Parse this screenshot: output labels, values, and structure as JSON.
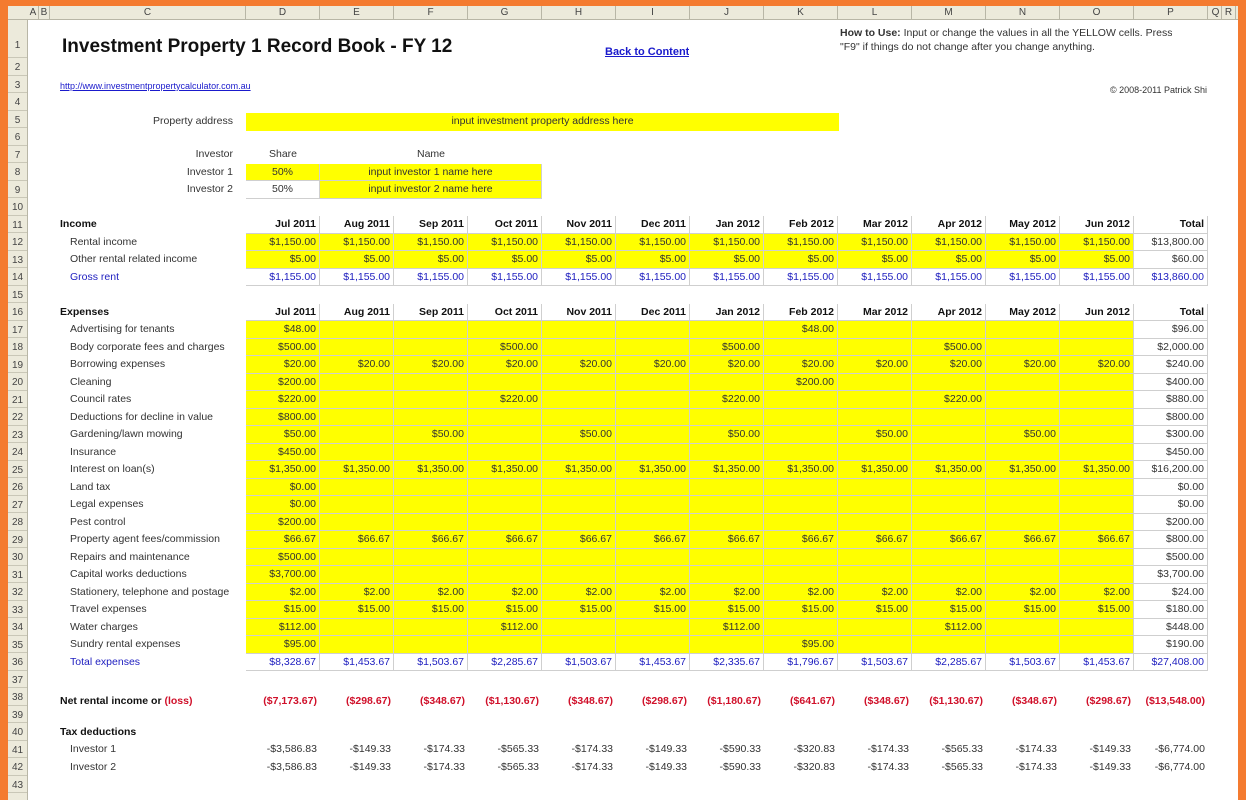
{
  "columns": [
    "A",
    "B",
    "C",
    "D",
    "E",
    "F",
    "G",
    "H",
    "I",
    "J",
    "K",
    "L",
    "M",
    "N",
    "O",
    "P",
    "Q",
    "R"
  ],
  "rows": [
    "1",
    "2",
    "3",
    "4",
    "5",
    "6",
    "7",
    "8",
    "9",
    "10",
    "11",
    "12",
    "13",
    "14",
    "15",
    "16",
    "17",
    "18",
    "19",
    "20",
    "21",
    "22",
    "23",
    "24",
    "25",
    "26",
    "27",
    "28",
    "29",
    "30",
    "31",
    "32",
    "33",
    "34",
    "35",
    "36",
    "37",
    "38",
    "39",
    "40",
    "41",
    "42",
    "43"
  ],
  "header": {
    "title": "Investment Property 1 Record Book - FY 12",
    "back_link": "Back to Content",
    "website_link": "http://www.investmentpropertycalculator.com.au",
    "how_to_use_label": "How to Use:",
    "how_to_use_text1": " Input or change the values in all the YELLOW cells. Press",
    "how_to_use_text2": "\"F9\" if things do not change after you change anything.",
    "copyright": "© 2008-2011 Patrick Shi"
  },
  "property": {
    "label": "Property address",
    "value": "input investment property address here"
  },
  "investors": {
    "col_investor": "Investor",
    "col_share": "Share",
    "col_name": "Name",
    "list": [
      {
        "label": "Investor 1",
        "share": "50%",
        "name": "input investor 1 name here"
      },
      {
        "label": "Investor 2",
        "share": "50%",
        "name": "input investor 2 name here"
      }
    ]
  },
  "months": [
    "Jul 2011",
    "Aug 2011",
    "Sep 2011",
    "Oct 2011",
    "Nov 2011",
    "Dec 2011",
    "Jan 2012",
    "Feb 2012",
    "Mar 2012",
    "Apr 2012",
    "May 2012",
    "Jun 2012"
  ],
  "total_label": "Total",
  "income": {
    "heading": "Income",
    "rows": [
      {
        "label": "Rental income",
        "values": [
          "$1,150.00",
          "$1,150.00",
          "$1,150.00",
          "$1,150.00",
          "$1,150.00",
          "$1,150.00",
          "$1,150.00",
          "$1,150.00",
          "$1,150.00",
          "$1,150.00",
          "$1,150.00",
          "$1,150.00"
        ],
        "total": "$13,800.00"
      },
      {
        "label": "Other rental related income",
        "values": [
          "$5.00",
          "$5.00",
          "$5.00",
          "$5.00",
          "$5.00",
          "$5.00",
          "$5.00",
          "$5.00",
          "$5.00",
          "$5.00",
          "$5.00",
          "$5.00"
        ],
        "total": "$60.00"
      }
    ],
    "gross": {
      "label": "Gross rent",
      "values": [
        "$1,155.00",
        "$1,155.00",
        "$1,155.00",
        "$1,155.00",
        "$1,155.00",
        "$1,155.00",
        "$1,155.00",
        "$1,155.00",
        "$1,155.00",
        "$1,155.00",
        "$1,155.00",
        "$1,155.00"
      ],
      "total": "$13,860.00"
    }
  },
  "expenses": {
    "heading": "Expenses",
    "rows": [
      {
        "label": "Advertising for tenants",
        "values": [
          "$48.00",
          "",
          "",
          "",
          "",
          "",
          "",
          "$48.00",
          "",
          "",
          "",
          ""
        ],
        "total": "$96.00"
      },
      {
        "label": "Body corporate fees and charges",
        "values": [
          "$500.00",
          "",
          "",
          "$500.00",
          "",
          "",
          "$500.00",
          "",
          "",
          "$500.00",
          "",
          ""
        ],
        "total": "$2,000.00"
      },
      {
        "label": "Borrowing expenses",
        "values": [
          "$20.00",
          "$20.00",
          "$20.00",
          "$20.00",
          "$20.00",
          "$20.00",
          "$20.00",
          "$20.00",
          "$20.00",
          "$20.00",
          "$20.00",
          "$20.00"
        ],
        "total": "$240.00"
      },
      {
        "label": "Cleaning",
        "values": [
          "$200.00",
          "",
          "",
          "",
          "",
          "",
          "",
          "$200.00",
          "",
          "",
          "",
          ""
        ],
        "total": "$400.00"
      },
      {
        "label": "Council rates",
        "values": [
          "$220.00",
          "",
          "",
          "$220.00",
          "",
          "",
          "$220.00",
          "",
          "",
          "$220.00",
          "",
          ""
        ],
        "total": "$880.00"
      },
      {
        "label": "Deductions for decline in value",
        "values": [
          "$800.00",
          "",
          "",
          "",
          "",
          "",
          "",
          "",
          "",
          "",
          "",
          ""
        ],
        "total": "$800.00"
      },
      {
        "label": "Gardening/lawn mowing",
        "values": [
          "$50.00",
          "",
          "$50.00",
          "",
          "$50.00",
          "",
          "$50.00",
          "",
          "$50.00",
          "",
          "$50.00",
          ""
        ],
        "total": "$300.00"
      },
      {
        "label": "Insurance",
        "values": [
          "$450.00",
          "",
          "",
          "",
          "",
          "",
          "",
          "",
          "",
          "",
          "",
          ""
        ],
        "total": "$450.00"
      },
      {
        "label": "Interest on loan(s)",
        "values": [
          "$1,350.00",
          "$1,350.00",
          "$1,350.00",
          "$1,350.00",
          "$1,350.00",
          "$1,350.00",
          "$1,350.00",
          "$1,350.00",
          "$1,350.00",
          "$1,350.00",
          "$1,350.00",
          "$1,350.00"
        ],
        "total": "$16,200.00"
      },
      {
        "label": "Land tax",
        "values": [
          "$0.00",
          "",
          "",
          "",
          "",
          "",
          "",
          "",
          "",
          "",
          "",
          ""
        ],
        "total": "$0.00"
      },
      {
        "label": "Legal expenses",
        "values": [
          "$0.00",
          "",
          "",
          "",
          "",
          "",
          "",
          "",
          "",
          "",
          "",
          ""
        ],
        "total": "$0.00"
      },
      {
        "label": "Pest control",
        "values": [
          "$200.00",
          "",
          "",
          "",
          "",
          "",
          "",
          "",
          "",
          "",
          "",
          ""
        ],
        "total": "$200.00"
      },
      {
        "label": "Property agent fees/commission",
        "values": [
          "$66.67",
          "$66.67",
          "$66.67",
          "$66.67",
          "$66.67",
          "$66.67",
          "$66.67",
          "$66.67",
          "$66.67",
          "$66.67",
          "$66.67",
          "$66.67"
        ],
        "total": "$800.00"
      },
      {
        "label": "Repairs and maintenance",
        "values": [
          "$500.00",
          "",
          "",
          "",
          "",
          "",
          "",
          "",
          "",
          "",
          "",
          ""
        ],
        "total": "$500.00"
      },
      {
        "label": "Capital works deductions",
        "values": [
          "$3,700.00",
          "",
          "",
          "",
          "",
          "",
          "",
          "",
          "",
          "",
          "",
          ""
        ],
        "total": "$3,700.00"
      },
      {
        "label": "Stationery, telephone and postage",
        "values": [
          "$2.00",
          "$2.00",
          "$2.00",
          "$2.00",
          "$2.00",
          "$2.00",
          "$2.00",
          "$2.00",
          "$2.00",
          "$2.00",
          "$2.00",
          "$2.00"
        ],
        "total": "$24.00"
      },
      {
        "label": "Travel expenses",
        "values": [
          "$15.00",
          "$15.00",
          "$15.00",
          "$15.00",
          "$15.00",
          "$15.00",
          "$15.00",
          "$15.00",
          "$15.00",
          "$15.00",
          "$15.00",
          "$15.00"
        ],
        "total": "$180.00"
      },
      {
        "label": "Water charges",
        "values": [
          "$112.00",
          "",
          "",
          "$112.00",
          "",
          "",
          "$112.00",
          "",
          "",
          "$112.00",
          "",
          ""
        ],
        "total": "$448.00"
      },
      {
        "label": "Sundry rental expenses",
        "values": [
          "$95.00",
          "",
          "",
          "",
          "",
          "",
          "",
          "$95.00",
          "",
          "",
          "",
          ""
        ],
        "total": "$190.00"
      }
    ],
    "total": {
      "label": "Total expenses",
      "values": [
        "$8,328.67",
        "$1,453.67",
        "$1,503.67",
        "$2,285.67",
        "$1,503.67",
        "$1,453.67",
        "$2,335.67",
        "$1,796.67",
        "$1,503.67",
        "$2,285.67",
        "$1,503.67",
        "$1,453.67"
      ],
      "total": "$27,408.00"
    }
  },
  "net": {
    "label": "Net rental income or ",
    "label_loss": "(loss)",
    "values": [
      "($7,173.67)",
      "($298.67)",
      "($348.67)",
      "($1,130.67)",
      "($348.67)",
      "($298.67)",
      "($1,180.67)",
      "($641.67)",
      "($348.67)",
      "($1,130.67)",
      "($348.67)",
      "($298.67)"
    ],
    "total": "($13,548.00)"
  },
  "tax": {
    "heading": "Tax deductions",
    "rows": [
      {
        "label": "Investor 1",
        "values": [
          "-$3,586.83",
          "-$149.33",
          "-$174.33",
          "-$565.33",
          "-$174.33",
          "-$149.33",
          "-$590.33",
          "-$320.83",
          "-$174.33",
          "-$565.33",
          "-$174.33",
          "-$149.33"
        ],
        "total": "-$6,774.00"
      },
      {
        "label": "Investor 2",
        "values": [
          "-$3,586.83",
          "-$149.33",
          "-$174.33",
          "-$565.33",
          "-$174.33",
          "-$149.33",
          "-$590.33",
          "-$320.83",
          "-$174.33",
          "-$565.33",
          "-$174.33",
          "-$149.33"
        ],
        "total": "-$6,774.00"
      }
    ]
  }
}
